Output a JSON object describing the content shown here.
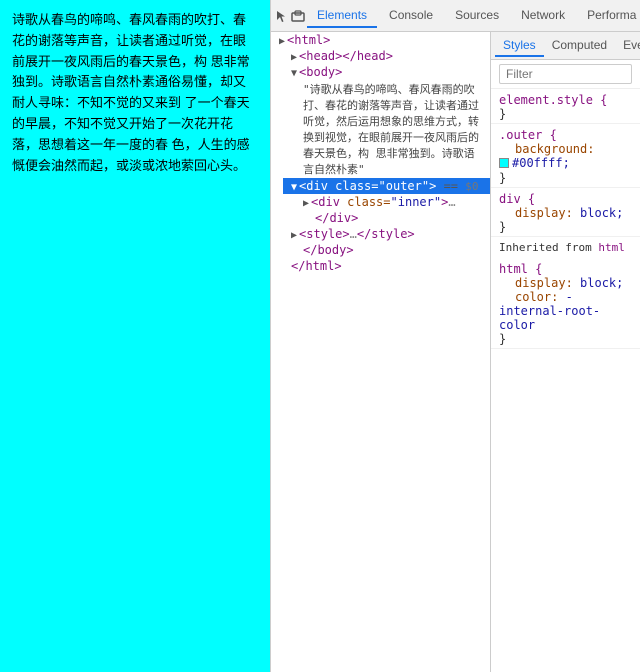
{
  "webpage": {
    "content": "诗歌从春鸟的啼鸣、春风春雨的吹打、春花的谢落等声音，让读者通过听觉，在眼前展开一夜风雨后的春天景色，构 思非常独到。诗歌语言自然朴素通俗易懂，却又耐人寻味：不知不觉的又来到 了一个春天的早晨，不知不觉又开始了一次花开花落，思想着这一年一度的春 色，人生的感慨便会油然而起，或淡或浓地萦回心头。"
  },
  "devtools": {
    "topbar_icons": [
      "cursor-icon",
      "box-icon"
    ],
    "main_tabs": [
      "Elements",
      "Console",
      "Sources",
      "Network",
      "Performa"
    ],
    "active_main_tab": "Elements",
    "elements": {
      "lines": [
        {
          "indent": 0,
          "content": "▶ <html>"
        },
        {
          "indent": 1,
          "content": "▶ <head></head>"
        },
        {
          "indent": 1,
          "content": "▼ <body>"
        },
        {
          "indent": 2,
          "content": "\"诗歌从春鸟的啼鸣、春风春雨的吹打、春花的谢落等声音，让读者通过听觉，在眼前展开一夜风、雨后的春天景色，构 思非常独到。诗歌语言自然朴素\""
        },
        {
          "indent": 1,
          "selected": true,
          "content": "▼ <div class=\"outer\"> == $0"
        },
        {
          "indent": 2,
          "content": "▶ <div class=\"inner\">…"
        },
        {
          "indent": 2,
          "content": "</div>"
        },
        {
          "indent": 1,
          "content": "▶ <style>…</style>"
        },
        {
          "indent": 1,
          "content": "</body>"
        },
        {
          "indent": 0,
          "content": "</html>"
        }
      ]
    },
    "styles": {
      "sub_tabs": [
        "Styles",
        "Computed",
        "Event Listene"
      ],
      "active_sub_tab": "Styles",
      "filter_placeholder": "Filter",
      "rules": [
        {
          "selector": "element.style {",
          "props": []
        },
        {
          "selector": ".outer {",
          "props": [
            {
              "name": "background:",
              "value": "▣ #00ffff;",
              "has_swatch": true,
              "swatch_color": "#00ffff"
            }
          ]
        },
        {
          "selector": "div {",
          "props": [
            {
              "name": "display:",
              "value": "block;"
            }
          ]
        }
      ],
      "inherited_from": "html",
      "inherited_rules": [
        {
          "selector": "html {",
          "props": [
            {
              "name": "display:",
              "value": "block;"
            },
            {
              "name": "color:",
              "value": "-internal-root-color"
            }
          ]
        }
      ]
    }
  }
}
